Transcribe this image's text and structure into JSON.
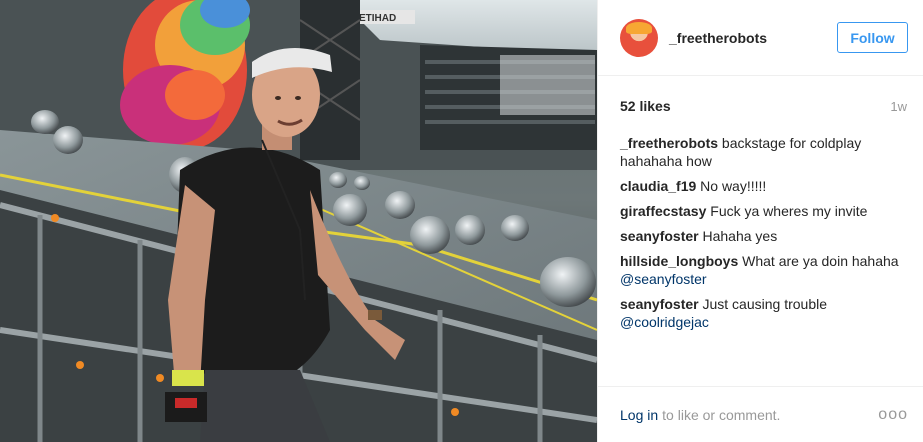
{
  "post": {
    "username": "_freetherobots",
    "follow_label": "Follow",
    "likes": "52 likes",
    "age": "1w",
    "caption": {
      "user": "_freetherobots",
      "text": "backstage for coldplay hahahaha how"
    },
    "comments": [
      {
        "user": "claudia_f19",
        "text": "No way!!!!!",
        "mention": ""
      },
      {
        "user": "giraffecstasy",
        "text": "Fuck ya wheres my invite",
        "mention": ""
      },
      {
        "user": "seanyfoster",
        "text": "Hahaha yes",
        "mention": ""
      },
      {
        "user": "hillside_longboys",
        "text": "What are ya doin hahaha",
        "mention": "@seanyfoster"
      },
      {
        "user": "seanyfoster",
        "text": "Just causing trouble",
        "mention": "@coolridgejac"
      }
    ],
    "footer": {
      "login_label": "Log in",
      "login_rest": "to like or comment.",
      "more_icon": "ooo"
    }
  },
  "photo": {
    "stadium_sign": "ETIHAD"
  },
  "colors": {
    "accent": "#3897f0",
    "link": "#003569",
    "muted": "#999999"
  }
}
